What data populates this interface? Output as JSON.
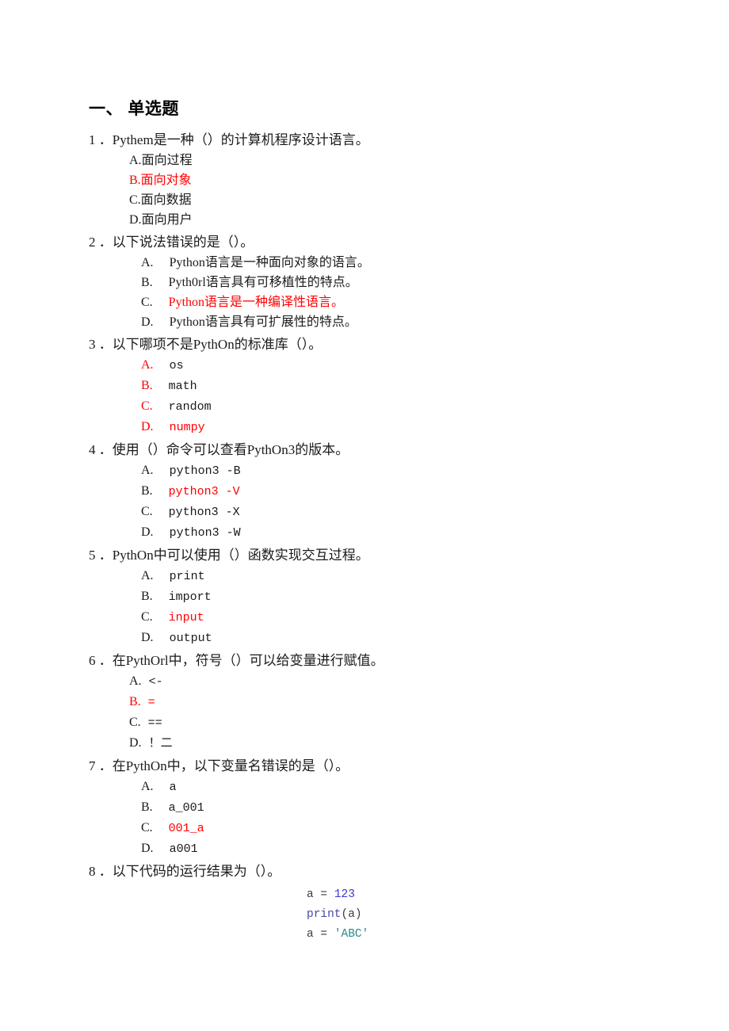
{
  "document": {
    "section_heading": "一、 单选题"
  },
  "questions": [
    {
      "number": "1 ．",
      "stem": "Pythem是一种（）的计算机程序设计语言。",
      "option_style": "tight",
      "option_text_style": "cjk",
      "options": [
        {
          "letter": "A.",
          "text": "面向过程",
          "letter_red": false,
          "text_red": false
        },
        {
          "letter": "B.",
          "text": "面向对象",
          "letter_red": true,
          "text_red": true
        },
        {
          "letter": "C.",
          "text": "面向数据",
          "letter_red": false,
          "text_red": false
        },
        {
          "letter": "D.",
          "text": "面向用户",
          "letter_red": false,
          "text_red": false
        }
      ]
    },
    {
      "number": "2 ．",
      "stem": "以下说法错误的是（）。",
      "option_style": "tabbed",
      "option_text_style": "cjk",
      "options": [
        {
          "letter": "A.",
          "text": "Python语言是一种面向对象的语言。",
          "letter_red": false,
          "text_red": false
        },
        {
          "letter": "B.",
          "text": "Pyth0rl语言具有可移植性的特点。",
          "letter_red": false,
          "text_red": false
        },
        {
          "letter": "C.",
          "text": "Python语言是一种编译性语言。",
          "letter_red": false,
          "text_red": true
        },
        {
          "letter": "D.",
          "text": "Python语言具有可扩展性的特点。",
          "letter_red": false,
          "text_red": false
        }
      ]
    },
    {
      "number": "3 ．",
      "stem": "以下哪项不是PythOn的标准库（）。",
      "option_style": "tabbed",
      "option_text_style": "mono",
      "options": [
        {
          "letter": "A.",
          "text": "os",
          "letter_red": true,
          "text_red": false
        },
        {
          "letter": "B.",
          "text": "math",
          "letter_red": true,
          "text_red": false
        },
        {
          "letter": "C.",
          "text": "random",
          "letter_red": true,
          "text_red": false
        },
        {
          "letter": "D.",
          "text": "numpy",
          "letter_red": true,
          "text_red": true
        }
      ]
    },
    {
      "number": "4 ．",
      "stem": "使用（）命令可以查看PythOn3的版本。",
      "option_style": "tabbed",
      "option_text_style": "mono",
      "options": [
        {
          "letter": "A.",
          "text": "python3 -B",
          "letter_red": false,
          "text_red": false
        },
        {
          "letter": "B.",
          "text": "python3 -V",
          "letter_red": false,
          "text_red": true
        },
        {
          "letter": "C.",
          "text": "python3 -X",
          "letter_red": false,
          "text_red": false
        },
        {
          "letter": "D.",
          "text": "python3 -W",
          "letter_red": false,
          "text_red": false
        }
      ]
    },
    {
      "number": "5 ．",
      "stem": "PythOn中可以使用（）函数实现交互过程。",
      "option_style": "tabbed",
      "option_text_style": "mono",
      "options": [
        {
          "letter": "A.",
          "text": "print",
          "letter_red": false,
          "text_red": false
        },
        {
          "letter": "B.",
          "text": "import",
          "letter_red": false,
          "text_red": false
        },
        {
          "letter": "C.",
          "text": "input",
          "letter_red": false,
          "text_red": true
        },
        {
          "letter": "D.",
          "text": "output",
          "letter_red": false,
          "text_red": false
        }
      ]
    },
    {
      "number": "6 ．",
      "stem": "在PythOrl中，符号（）可以给变量进行赋值。",
      "option_style": "tight",
      "option_text_style": "mono",
      "options": [
        {
          "letter": "A.",
          "text": " <-",
          "letter_red": false,
          "text_red": false
        },
        {
          "letter": "B.",
          "text": " =",
          "letter_red": true,
          "text_red": true
        },
        {
          "letter": "C.",
          "text": " ==",
          "letter_red": false,
          "text_red": false
        },
        {
          "letter": "D.",
          "text": " ！二",
          "letter_red": false,
          "text_red": false
        }
      ]
    },
    {
      "number": "7 ．",
      "stem": "在PythOn中，以下变量名错误的是（）。",
      "option_style": "tabbed",
      "option_text_style": "mono",
      "options": [
        {
          "letter": "A.",
          "text": "a",
          "letter_red": false,
          "text_red": false
        },
        {
          "letter": "B.",
          "text": "a_001",
          "letter_red": false,
          "text_red": false
        },
        {
          "letter": "C.",
          "text": "001_a",
          "letter_red": false,
          "text_red": true
        },
        {
          "letter": "D.",
          "text": "a001",
          "letter_red": false,
          "text_red": false
        }
      ]
    },
    {
      "number": "8 ．",
      "stem": "以下代码的运行结果为（）。",
      "option_style": "tabbed",
      "option_text_style": "mono",
      "options": []
    }
  ],
  "code_block": {
    "lines": [
      [
        {
          "text": "a ",
          "token": "name"
        },
        {
          "text": "= ",
          "token": "op"
        },
        {
          "text": "123",
          "token": "number"
        }
      ],
      [
        {
          "text": "print",
          "token": "func"
        },
        {
          "text": "(a)",
          "token": "punct"
        }
      ],
      [
        {
          "text": "a ",
          "token": "name"
        },
        {
          "text": "= ",
          "token": "op"
        },
        {
          "text": "'ABC'",
          "token": "string"
        }
      ]
    ]
  },
  "colors": {
    "answer_red": "#ff0000",
    "text_black": "#1a1a1a",
    "code_number": "#3b3bc8",
    "code_function": "#4545a8",
    "code_string": "#2e8b8b",
    "page_background": "#ffffff"
  }
}
